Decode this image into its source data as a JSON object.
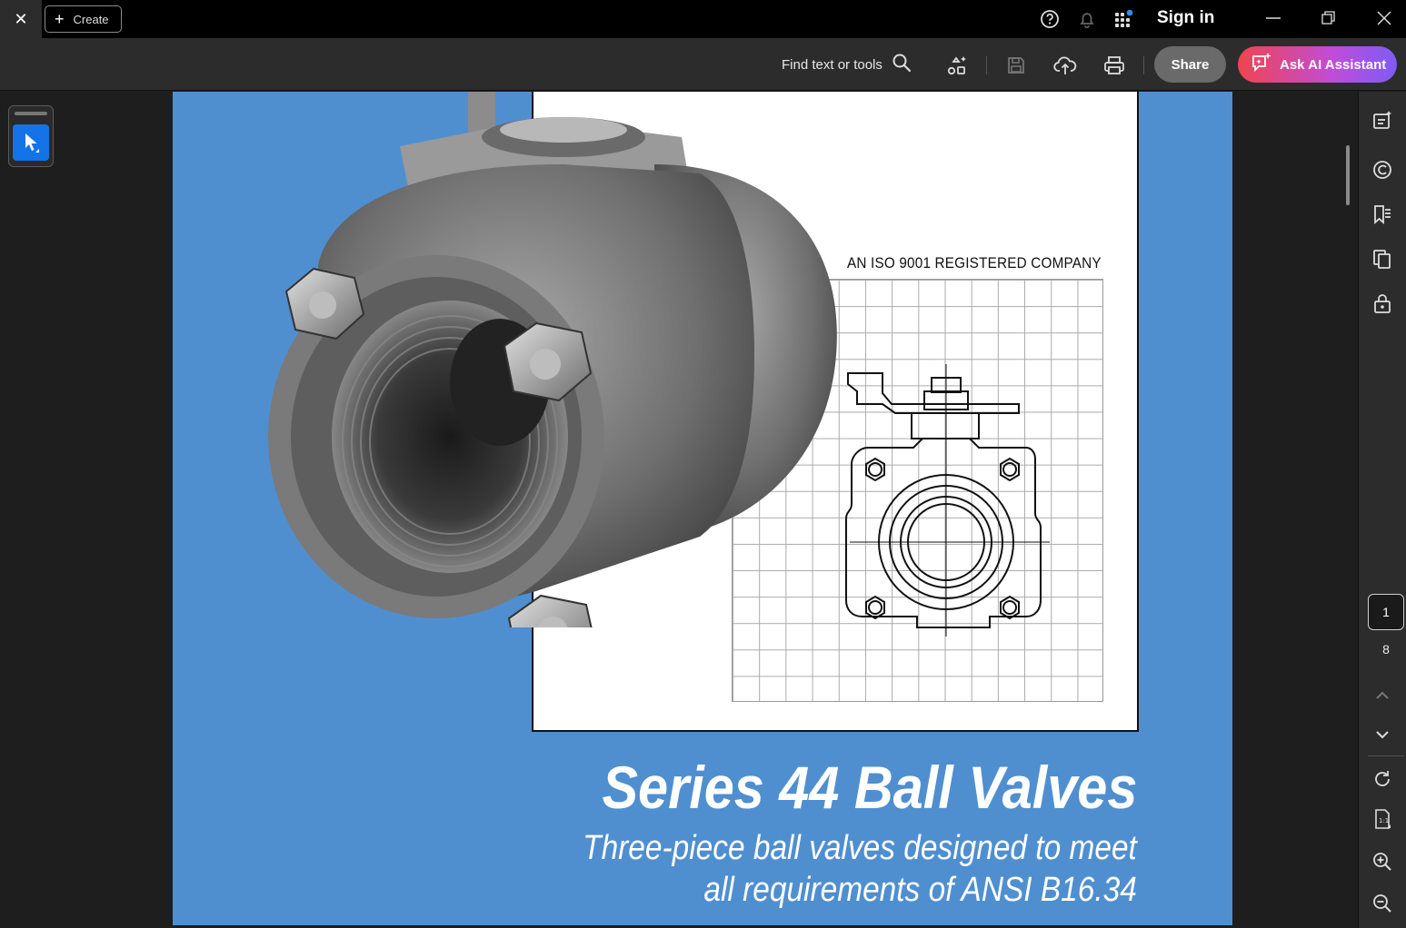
{
  "titlebar": {
    "close_glyph": "✕",
    "create_label": "Create",
    "sign_in_label": "Sign in",
    "icons": [
      "help-icon",
      "bell-icon",
      "apps-grid-icon"
    ],
    "window_controls": [
      "minimize-icon",
      "restore-icon",
      "close-icon"
    ]
  },
  "toolbar": {
    "find_label": "Find text or tools",
    "share_label": "Share",
    "ai_label": "Ask AI Assistant",
    "icons": [
      "search-icon",
      "ai-tools-icon",
      "save-icon",
      "cloud-upload-icon",
      "print-icon"
    ]
  },
  "left_rail": {
    "tool": "select-cursor-icon"
  },
  "document": {
    "iso_text": "AN ISO 9001 REGISTERED COMPANY",
    "title": "Series 44 Ball Valves",
    "subtitle_line1": "Three-piece ball valves designed to meet",
    "subtitle_line2": "all requirements of ANSI B16.34"
  },
  "right_rail": {
    "icons": [
      "edit-pdf-icon",
      "comment-icon",
      "bookmark-icon",
      "pages-icon",
      "lock-icon",
      "chevron-up-icon",
      "chevron-down-icon",
      "rotate-icon",
      "fit-page-icon",
      "zoom-in-icon",
      "zoom-out-icon"
    ],
    "current_page": "1",
    "total_pages": "8"
  },
  "colors": {
    "page_background": "#4f8fd0",
    "accent_blue": "#1473e6",
    "ai_gradient_start": "#f0454f",
    "ai_gradient_end": "#7d5cf5"
  }
}
